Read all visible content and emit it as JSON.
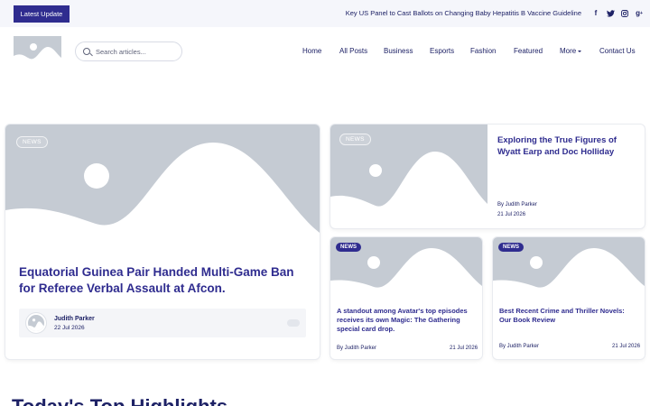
{
  "topbar": {
    "latest_label": "Latest Update",
    "ticker": "Key US Panel to Cast Ballots on Changing Baby Hepatitis B Vaccine Guideline",
    "social": [
      "facebook-icon",
      "twitter-icon",
      "instagram-icon",
      "google-plus-icon"
    ]
  },
  "search": {
    "placeholder": "Search articles..."
  },
  "nav": {
    "items": [
      "Home",
      "All Posts",
      "Business",
      "Esports",
      "Fashion",
      "Featured",
      "More",
      "Contact Us"
    ]
  },
  "featured": {
    "tag": "NEWS",
    "title": "Equatorial Guinea Pair Handed Multi-Game Ban for Referee Verbal Assault at Afcon.",
    "author": "Judith Parker",
    "date": "22 Jul 2026"
  },
  "side_top": {
    "tag": "NEWS",
    "title": "Exploring the True Figures of Wyatt Earp and Doc Holliday",
    "author": "By Judith Parker",
    "date": "21 Jul 2026"
  },
  "small_cards": [
    {
      "tag": "NEWS",
      "title": "A standout among Avatar's top episodes receives its own Magic: The Gathering special card drop.",
      "author": "By Judith Parker",
      "date": "21 Jul 2026"
    },
    {
      "tag": "NEWS",
      "title": "Best Recent Crime and Thriller Novels: Our Book Review",
      "author": "By Judith Parker",
      "date": "21 Jul 2026"
    }
  ],
  "section_title": "Today's Top Highlights",
  "colors": {
    "accent": "#2f2c8f",
    "placeholder": "#c5cbd3",
    "topbar_bg": "#f5f6fb"
  }
}
